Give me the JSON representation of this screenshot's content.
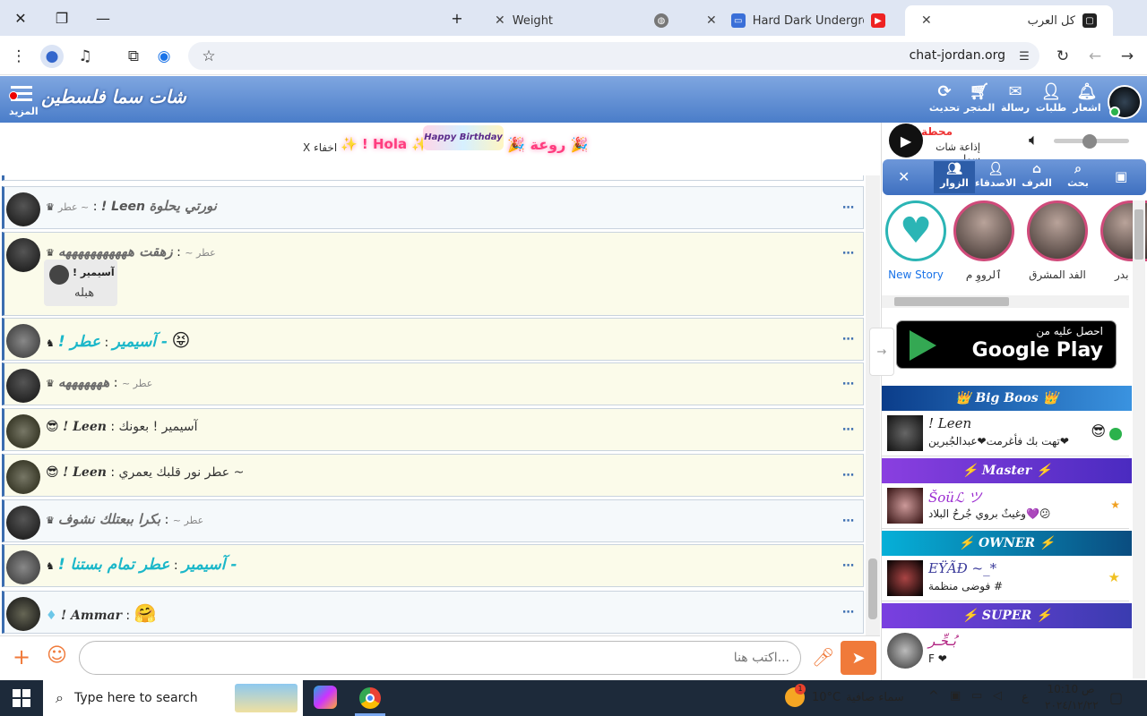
{
  "browser": {
    "tabs": [
      {
        "title": "Weight",
        "icon": "globe-icon"
      },
      {
        "title": "Hard Dark Underground IN",
        "icon": "youtube-icon"
      },
      {
        "title": "كل العرب",
        "icon": "chat-icon"
      }
    ],
    "url": "chat-jordan.org"
  },
  "site": {
    "logo_text": "شات سما فلسطين",
    "more_label": "المزيد",
    "header_buttons": [
      {
        "label": "اشعار",
        "icon": "bell-icon"
      },
      {
        "label": "طلبات",
        "icon": "add-user-icon"
      },
      {
        "label": "رسالة",
        "icon": "mail-icon"
      },
      {
        "label": "المتجر",
        "icon": "cart-icon"
      },
      {
        "label": "تحديث",
        "icon": "refresh-icon"
      }
    ]
  },
  "announcement": {
    "text": "! Hola",
    "hide_label": "X اخفاء",
    "banner_text": "Happy Birthday",
    "extra": "روعة"
  },
  "radio": {
    "station_label": "محطة",
    "station_name": "إذاعة شات سما"
  },
  "messages": [
    {
      "name": "! Leen",
      "text": "نورتي يحلوة",
      "prefix": "عطر ~"
    },
    {
      "name": "",
      "text": "زهقت هههههههههههه",
      "prefix": "عطر ~",
      "quote_name": "! آسيمير",
      "quote_text": "هبله"
    },
    {
      "name": "! آسيمير",
      "text": "عطر -",
      "prefix": "",
      "style": "cyan"
    },
    {
      "name": "",
      "text": "هههههههه",
      "prefix": "عطر ~"
    },
    {
      "name": "! Leen",
      "text": "آسيمير ! بعونك",
      "prefix": ""
    },
    {
      "name": "! Leen",
      "text": "عطر نور قلبك يعمري ~",
      "prefix": ""
    },
    {
      "name": "",
      "text": "بكرا ببعتلك نشوف",
      "prefix": "عطر ~"
    },
    {
      "name": "! آسيمير",
      "text": "عطر تمام بستنا -",
      "prefix": "",
      "style": "cyan"
    },
    {
      "name": "! Ammar",
      "text": "",
      "prefix": ""
    }
  ],
  "input": {
    "placeholder": "...اكتب هنا"
  },
  "nav_tabs": [
    {
      "label": "بحث",
      "icon": "search-icon"
    },
    {
      "label": "الغرف",
      "icon": "home-icon"
    },
    {
      "label": "الاصدقاء",
      "icon": "user-icon"
    },
    {
      "label": "الزوار",
      "icon": "users-icon"
    }
  ],
  "stories": [
    {
      "label": "New Story"
    },
    {
      "label": "ٱلرووِ م"
    },
    {
      "label": "الفد المشرق"
    },
    {
      "label": "بدر"
    }
  ],
  "google_play": {
    "line1": "احصل عليه من",
    "line2": "Google Play"
  },
  "sections": [
    {
      "title": "Big Boos",
      "color": "#1e6fc4",
      "users": [
        {
          "name": "! Leen",
          "status": "تهت بك فأغرمت❤عبدالجُبرين❤"
        }
      ]
    },
    {
      "title": "Master",
      "color": "#6b3fd6",
      "users": [
        {
          "name": "Šoüℒ ツ",
          "status": "وغيثٌ بروي جُرحُ البلاد💜😕"
        }
      ]
    },
    {
      "title": "OWNER",
      "color": "#0a89b0",
      "users": [
        {
          "name": "ΕΫÃÐ ~_*",
          "status": "فوضى منظمة #"
        }
      ]
    },
    {
      "title": "SUPER",
      "color": "#4a3cb0",
      "users": [
        {
          "name": "بُـحِّـر",
          "status": "F ❤"
        }
      ]
    }
  ],
  "taskbar": {
    "search_placeholder": "Type here to search",
    "weather_temp": "10°C",
    "weather_text": "سماء صافية",
    "time": "10:10 ص",
    "date": "٢٠٢٤/١٢/٢٢",
    "lang": "ع"
  }
}
